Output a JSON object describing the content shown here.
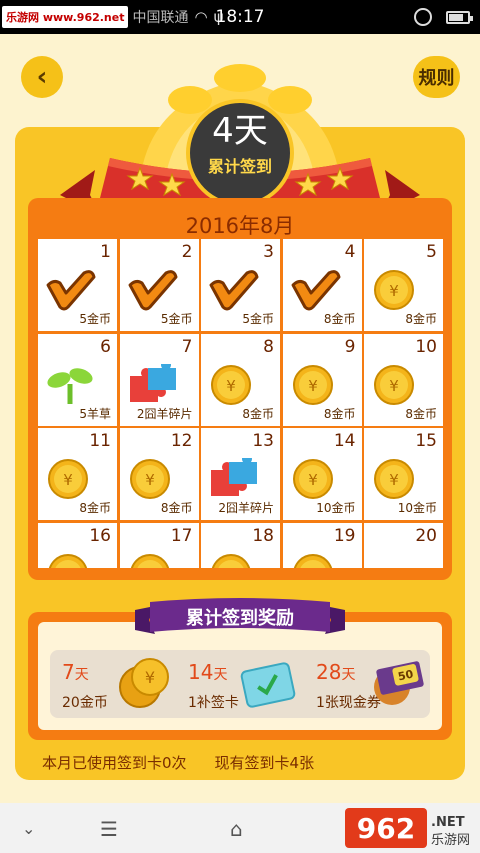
{
  "status_bar": {
    "watermark": "乐游网 www.962.net",
    "carrier": "中国联通",
    "time": "18:17"
  },
  "header": {
    "back_icon": "chevron-left-icon",
    "rules_label": "规则"
  },
  "badge": {
    "days": "4天",
    "label": "累计签到"
  },
  "calendar": {
    "month": "2016年8月",
    "days": [
      {
        "day": "1",
        "icon": "checkmark",
        "reward": "5金币"
      },
      {
        "day": "2",
        "icon": "checkmark",
        "reward": "5金币"
      },
      {
        "day": "3",
        "icon": "checkmark",
        "reward": "5金币"
      },
      {
        "day": "4",
        "icon": "checkmark",
        "reward": "8金币"
      },
      {
        "day": "5",
        "icon": "coin",
        "reward": "8金币"
      },
      {
        "day": "6",
        "icon": "sprout",
        "reward": "5羊草"
      },
      {
        "day": "7",
        "icon": "puzzle",
        "reward": "2囧羊碎片"
      },
      {
        "day": "8",
        "icon": "coin",
        "reward": "8金币"
      },
      {
        "day": "9",
        "icon": "coin",
        "reward": "8金币"
      },
      {
        "day": "10",
        "icon": "coin",
        "reward": "8金币"
      },
      {
        "day": "11",
        "icon": "coin",
        "reward": "8金币"
      },
      {
        "day": "12",
        "icon": "coin",
        "reward": "8金币"
      },
      {
        "day": "13",
        "icon": "puzzle",
        "reward": "2囧羊碎片"
      },
      {
        "day": "14",
        "icon": "coin",
        "reward": "10金币"
      },
      {
        "day": "15",
        "icon": "coin",
        "reward": "10金币"
      },
      {
        "day": "16",
        "icon": "coin",
        "reward": ""
      },
      {
        "day": "17",
        "icon": "coin",
        "reward": ""
      },
      {
        "day": "18",
        "icon": "coin",
        "reward": ""
      },
      {
        "day": "19",
        "icon": "coin",
        "reward": ""
      },
      {
        "day": "20",
        "icon": "voucher",
        "reward": ""
      }
    ]
  },
  "rewards": {
    "title": "累计签到奖励",
    "items": [
      {
        "days": "7",
        "unit": "天",
        "desc": "20金币",
        "icon": "coin-stack"
      },
      {
        "days": "14",
        "unit": "天",
        "desc": "1补签卡",
        "icon": "calendar-card"
      },
      {
        "days": "28",
        "unit": "天",
        "desc": "1张现金券",
        "icon": "cash-voucher"
      }
    ],
    "voucher_value": "50"
  },
  "footer": {
    "used_cards": "本月已使用签到卡0次",
    "owned_cards": "现有签到卡4张"
  },
  "nav": {
    "logo_text": "962",
    "logo_net": ".NET",
    "logo_sub": "乐游网"
  },
  "colors": {
    "panel": "#f9c526",
    "frame": "#f57c12",
    "ribbon": "#d9302a",
    "purple": "#6b2a8c",
    "coin": "#f4b41a"
  }
}
